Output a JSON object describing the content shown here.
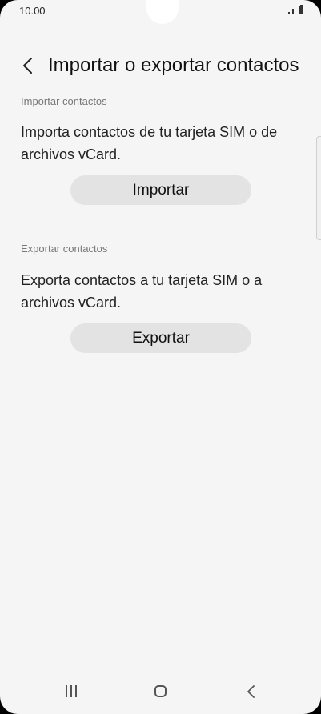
{
  "status_bar": {
    "time": "10.00"
  },
  "header": {
    "title": "Importar o exportar contactos",
    "back_icon": "chevron-left-icon"
  },
  "import_section": {
    "label": "Importar contactos",
    "description": "Importa contactos de tu tarjeta SIM o de archivos vCard.",
    "button_label": "Importar"
  },
  "export_section": {
    "label": "Exportar contactos",
    "description": "Exporta contactos a tu tarjeta SIM o a archivos vCard.",
    "button_label": "Exportar"
  },
  "nav_bar": {
    "icons": [
      "recent-apps-icon",
      "home-icon",
      "back-icon"
    ]
  },
  "colors": {
    "background": "#f5f5f5",
    "button_background": "#e3e3e3",
    "label_text": "#777777",
    "primary_text": "#111111"
  }
}
